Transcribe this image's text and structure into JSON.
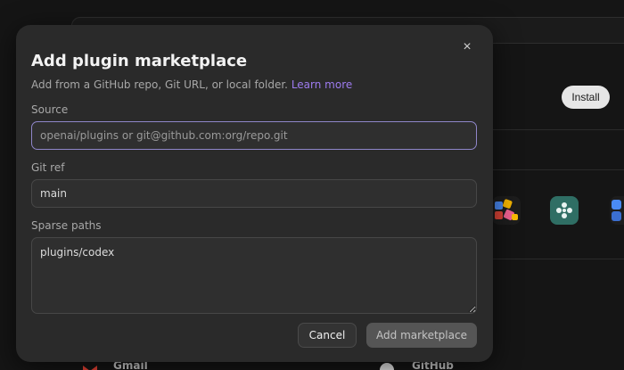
{
  "background": {
    "install_label": "Install",
    "bottom_left_label": "Gmail",
    "bottom_right_label": "GitHub",
    "icons": [
      "gmail-icon",
      "github-icon",
      "app-colorful-icon",
      "app-teal-icon",
      "app-blue-icon"
    ]
  },
  "dialog": {
    "title": "Add plugin marketplace",
    "subtitle": "Add from a GitHub repo, Git URL, or local folder.",
    "learn_more": "Learn more",
    "close_glyph": "×",
    "source": {
      "label": "Source",
      "placeholder": "openai/plugins or git@github.com:org/repo.git",
      "value": ""
    },
    "git_ref": {
      "label": "Git ref",
      "value": "main"
    },
    "sparse_paths": {
      "label": "Sparse paths",
      "value": "plugins/codex"
    },
    "cancel_label": "Cancel",
    "add_label": "Add marketplace"
  },
  "colors": {
    "accent_link": "#9d7bef",
    "focus_border": "#8f86c9",
    "modal_bg": "#2a2a2a"
  }
}
